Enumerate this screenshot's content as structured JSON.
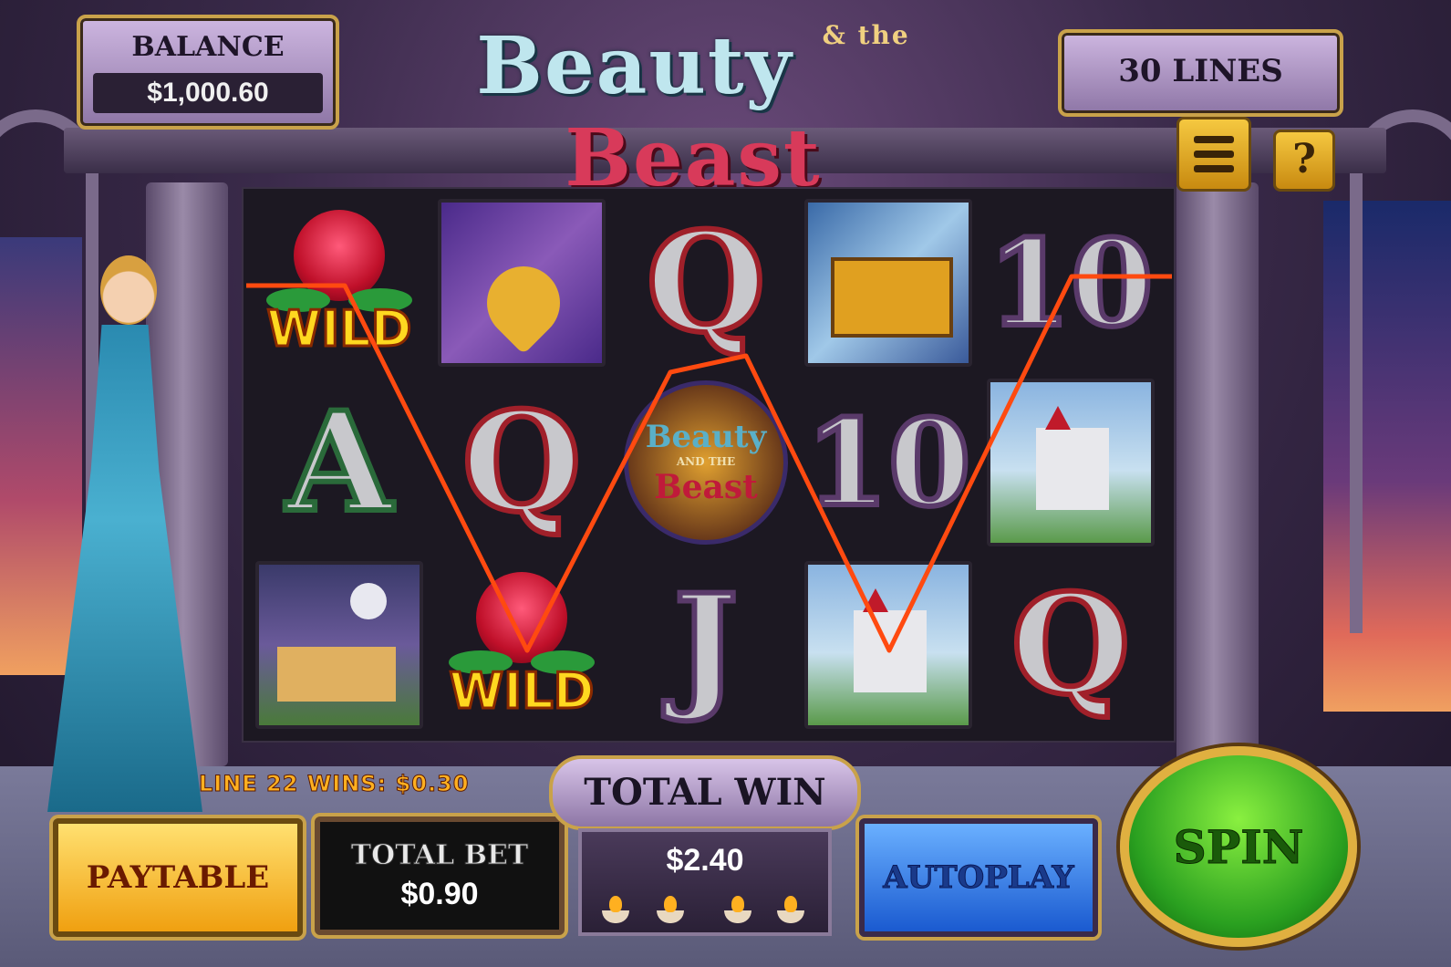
{
  "game": {
    "title_part1": "Beauty",
    "title_amp": "& the",
    "title_part2": "Beast"
  },
  "balance": {
    "label": "BALANCE",
    "value": "$1,000.60"
  },
  "lines": {
    "label": "30 LINES"
  },
  "help": {
    "glyph": "?"
  },
  "reels": {
    "grid": [
      [
        "wild",
        "A",
        "cottage"
      ],
      [
        "pendant",
        "Q",
        "wild"
      ],
      [
        "Q",
        "logo",
        "J"
      ],
      [
        "chest",
        "10",
        "castle"
      ],
      [
        "10",
        "castle",
        "Q"
      ]
    ],
    "wild_label": "WILD",
    "logo_symbol": {
      "line1": "Beauty",
      "line2": "AND THE",
      "line3": "Beast"
    }
  },
  "win_message": "LINE 22 WINS: $0.30",
  "buttons": {
    "paytable": "PAYTABLE",
    "autoplay": "AUTOPLAY",
    "spin": "SPIN"
  },
  "total_bet": {
    "label": "TOTAL BET",
    "value": "$0.90"
  },
  "total_win": {
    "label": "TOTAL WIN",
    "value": "$2.40"
  },
  "colors": {
    "payline": "#ff4a10",
    "spin_button": "#2aa020",
    "autoplay_button": "#1a5ad0",
    "paytable_button": "#f0a010",
    "frame_gold": "#c9a24a"
  }
}
